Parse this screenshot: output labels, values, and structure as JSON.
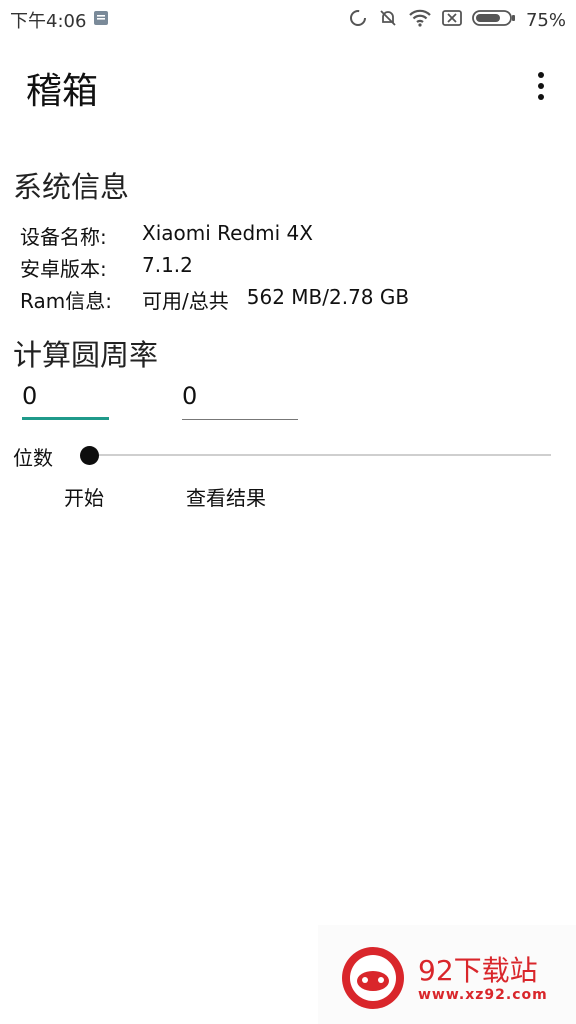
{
  "status_bar": {
    "time": "下午4:06",
    "battery_percent": "75%",
    "battery_level": 0.75,
    "icons": [
      "sync-icon",
      "do-not-disturb-icon",
      "wifi-icon",
      "sim-error-icon",
      "battery-icon"
    ]
  },
  "app_bar": {
    "title": "稽箱",
    "overflow_icon": "more-vert-icon"
  },
  "system_info": {
    "title": "系统信息",
    "device_label": "设备名称:",
    "device_value": "Xiaomi Redmi 4X",
    "android_label": "安卓版本:",
    "android_value": "7.1.2",
    "ram_label": "Ram信息:",
    "ram_available_label": "可用/总共",
    "ram_value": "562 MB/2.78 GB"
  },
  "pi_calc": {
    "title": "计算圆周率",
    "input1_value": "0",
    "input2_value": "0",
    "digits_label": "位数",
    "slider_value": 0,
    "start_label": "开始",
    "result_label": "查看结果"
  },
  "watermark": {
    "name": "92下载站",
    "url": "www.xz92.com"
  },
  "colors": {
    "accent": "#1f9a8a",
    "watermark_red": "#d9262b"
  }
}
